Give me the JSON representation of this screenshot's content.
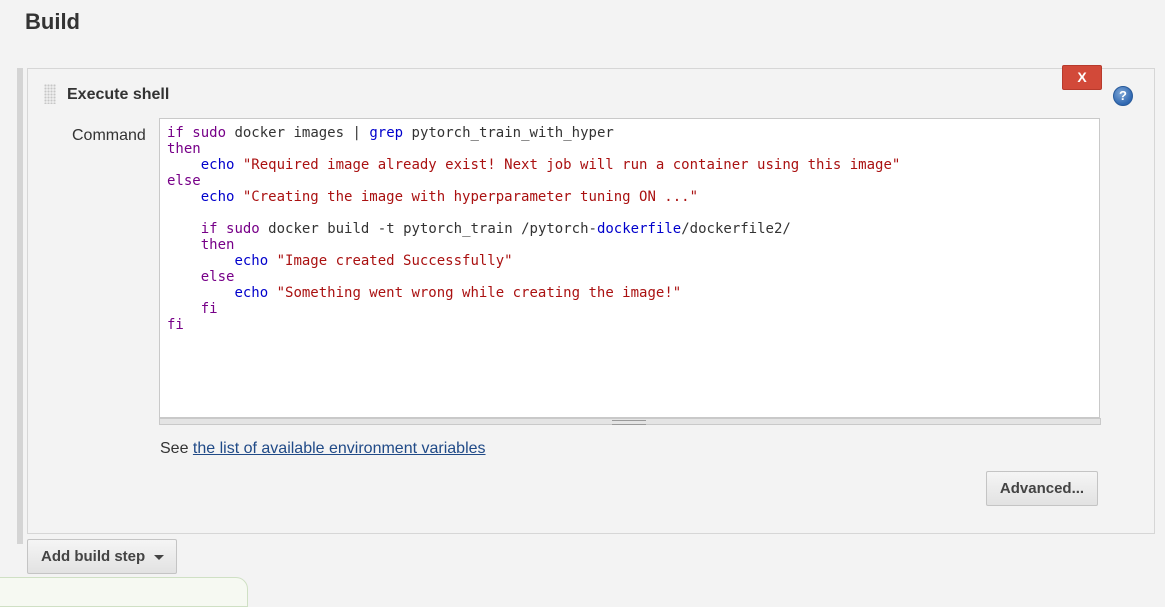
{
  "section": {
    "title": "Build"
  },
  "step": {
    "title": "Execute shell",
    "close_label": "X",
    "help_label": "?"
  },
  "command": {
    "label": "Command",
    "lines": [
      "if sudo docker images | grep pytorch_train_with_hyper",
      "then",
      "    echo \"Required image already exist! Next job will run a container using this image\"",
      "else",
      "    echo \"Creating the image with hyperparameter tuning ON ...\"",
      "",
      "    if sudo docker build -t pytorch_train /pytorch-dockerfile/dockerfile2/",
      "    then",
      "        echo \"Image created Successfully\"",
      "    else",
      "        echo \"Something went wrong while creating the image!\"",
      "    fi",
      "fi"
    ]
  },
  "env_vars": {
    "prefix": "See",
    "link_text": "the list of available environment variables"
  },
  "buttons": {
    "advanced": "Advanced...",
    "add_build_step": "Add build step"
  },
  "icons": {
    "drag": "drag-handle-icon",
    "close": "close-icon",
    "help": "help-icon",
    "dropdown": "caret-down-icon"
  },
  "colors": {
    "close_button": "#d24939",
    "help_icon": "#2f67b1",
    "link": "#204a87",
    "keyword": "#770088",
    "builtin": "#0000cc",
    "string": "#aa1111"
  }
}
